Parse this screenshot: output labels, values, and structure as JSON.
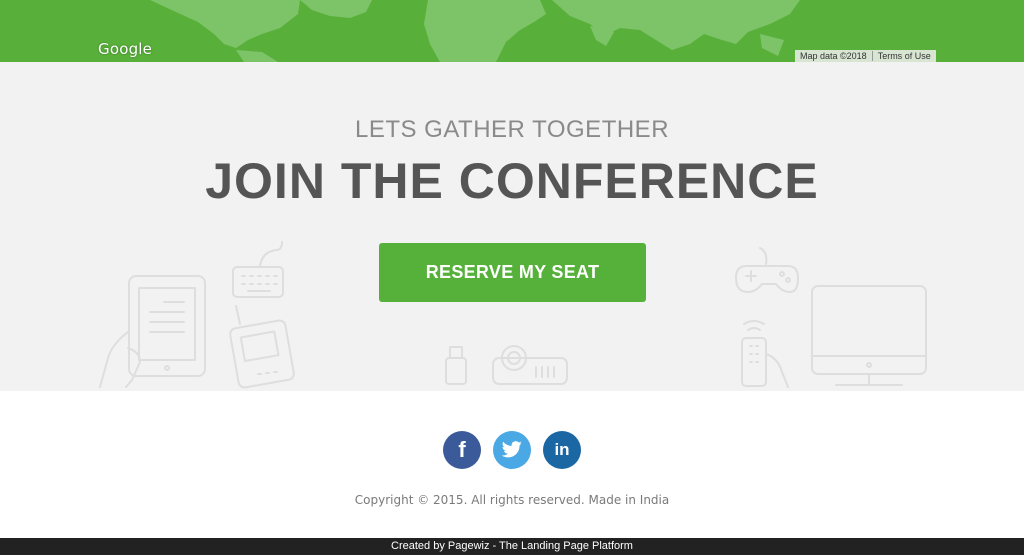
{
  "map": {
    "logo": "Google",
    "map_data": "Map data ©2018",
    "terms": "Terms of Use",
    "colors": {
      "land": "#7dc468",
      "sea": "#58b03a"
    }
  },
  "hero": {
    "eyebrow": "LETS GATHER TOGETHER",
    "headline": "JOIN THE CONFERENCE",
    "cta_label": "RESERVE MY SEAT",
    "colors": {
      "background": "#f2f2f2",
      "cta": "#55b13a",
      "headline": "#555555"
    },
    "illustrations": [
      "tablet-in-hand-icon",
      "keyboard-icon",
      "mobile-phone-icon",
      "usb-drive-icon",
      "projector-icon",
      "gamepad-icon",
      "remote-control-icon",
      "monitor-icon"
    ]
  },
  "social": {
    "facebook": "f",
    "linkedin": "in",
    "icons": [
      "facebook-icon",
      "twitter-icon",
      "linkedin-icon"
    ]
  },
  "footer": {
    "copyright": "Copyright © 2015. All rights reserved. Made in India",
    "credit": "Created by Pagewiz - The Landing Page Platform"
  }
}
